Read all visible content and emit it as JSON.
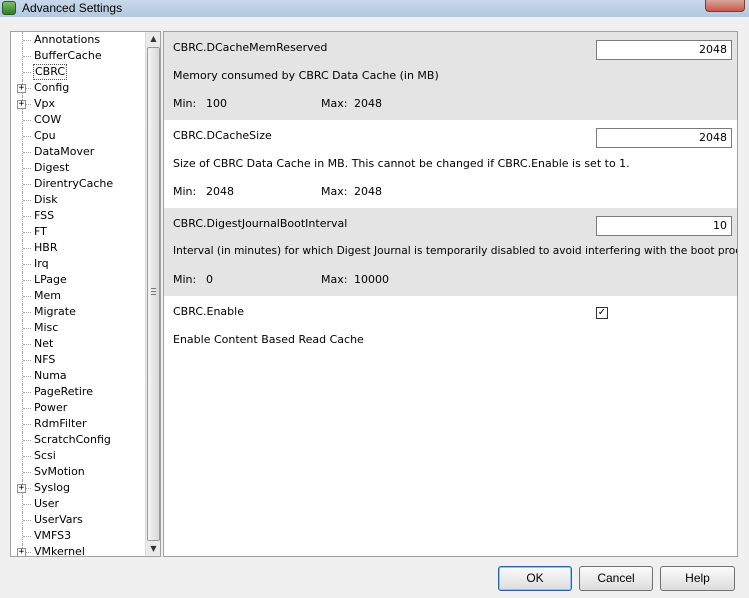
{
  "window": {
    "title": "Advanced Settings"
  },
  "tree": {
    "items": [
      {
        "label": "Annotations",
        "expandable": false,
        "selected": false
      },
      {
        "label": "BufferCache",
        "expandable": false,
        "selected": false
      },
      {
        "label": "CBRC",
        "expandable": false,
        "selected": true
      },
      {
        "label": "Config",
        "expandable": true,
        "selected": false
      },
      {
        "label": "Vpx",
        "expandable": true,
        "selected": false
      },
      {
        "label": "COW",
        "expandable": false,
        "selected": false
      },
      {
        "label": "Cpu",
        "expandable": false,
        "selected": false
      },
      {
        "label": "DataMover",
        "expandable": false,
        "selected": false
      },
      {
        "label": "Digest",
        "expandable": false,
        "selected": false
      },
      {
        "label": "DirentryCache",
        "expandable": false,
        "selected": false
      },
      {
        "label": "Disk",
        "expandable": false,
        "selected": false
      },
      {
        "label": "FSS",
        "expandable": false,
        "selected": false
      },
      {
        "label": "FT",
        "expandable": false,
        "selected": false
      },
      {
        "label": "HBR",
        "expandable": false,
        "selected": false
      },
      {
        "label": "Irq",
        "expandable": false,
        "selected": false
      },
      {
        "label": "LPage",
        "expandable": false,
        "selected": false
      },
      {
        "label": "Mem",
        "expandable": false,
        "selected": false
      },
      {
        "label": "Migrate",
        "expandable": false,
        "selected": false
      },
      {
        "label": "Misc",
        "expandable": false,
        "selected": false
      },
      {
        "label": "Net",
        "expandable": false,
        "selected": false
      },
      {
        "label": "NFS",
        "expandable": false,
        "selected": false
      },
      {
        "label": "Numa",
        "expandable": false,
        "selected": false
      },
      {
        "label": "PageRetire",
        "expandable": false,
        "selected": false
      },
      {
        "label": "Power",
        "expandable": false,
        "selected": false
      },
      {
        "label": "RdmFilter",
        "expandable": false,
        "selected": false
      },
      {
        "label": "ScratchConfig",
        "expandable": false,
        "selected": false
      },
      {
        "label": "Scsi",
        "expandable": false,
        "selected": false
      },
      {
        "label": "SvMotion",
        "expandable": false,
        "selected": false
      },
      {
        "label": "Syslog",
        "expandable": true,
        "selected": false
      },
      {
        "label": "User",
        "expandable": false,
        "selected": false
      },
      {
        "label": "UserVars",
        "expandable": false,
        "selected": false
      },
      {
        "label": "VMFS3",
        "expandable": false,
        "selected": false
      },
      {
        "label": "VMkernel",
        "expandable": true,
        "selected": false
      }
    ]
  },
  "settings": [
    {
      "name": "CBRC.DCacheMemReserved",
      "value": "2048",
      "description": "Memory consumed by CBRC Data Cache (in MB)",
      "min_label": "Min:",
      "min": "100",
      "max_label": "Max:",
      "max": "2048"
    },
    {
      "name": "CBRC.DCacheSize",
      "value": "2048",
      "description": "Size of CBRC Data Cache in MB. This cannot be changed if CBRC.Enable is set to 1.",
      "min_label": "Min:",
      "min": "2048",
      "max_label": "Max:",
      "max": "2048"
    },
    {
      "name": "CBRC.DigestJournalBootInterval",
      "value": "10",
      "description": "Interval (in minutes) for which Digest Journal is temporarily disabled to avoid interfering with the boot process",
      "min_label": "Min:",
      "min": "0",
      "max_label": "Max:",
      "max": "10000"
    },
    {
      "name": "CBRC.Enable",
      "checked": true,
      "checkmark": "✓",
      "description": "Enable Content Based Read Cache"
    }
  ],
  "buttons": {
    "ok": "OK",
    "cancel": "Cancel",
    "help": "Help"
  },
  "icons": {
    "expander": "+",
    "scroll_up": "▲",
    "scroll_down": "▼"
  }
}
